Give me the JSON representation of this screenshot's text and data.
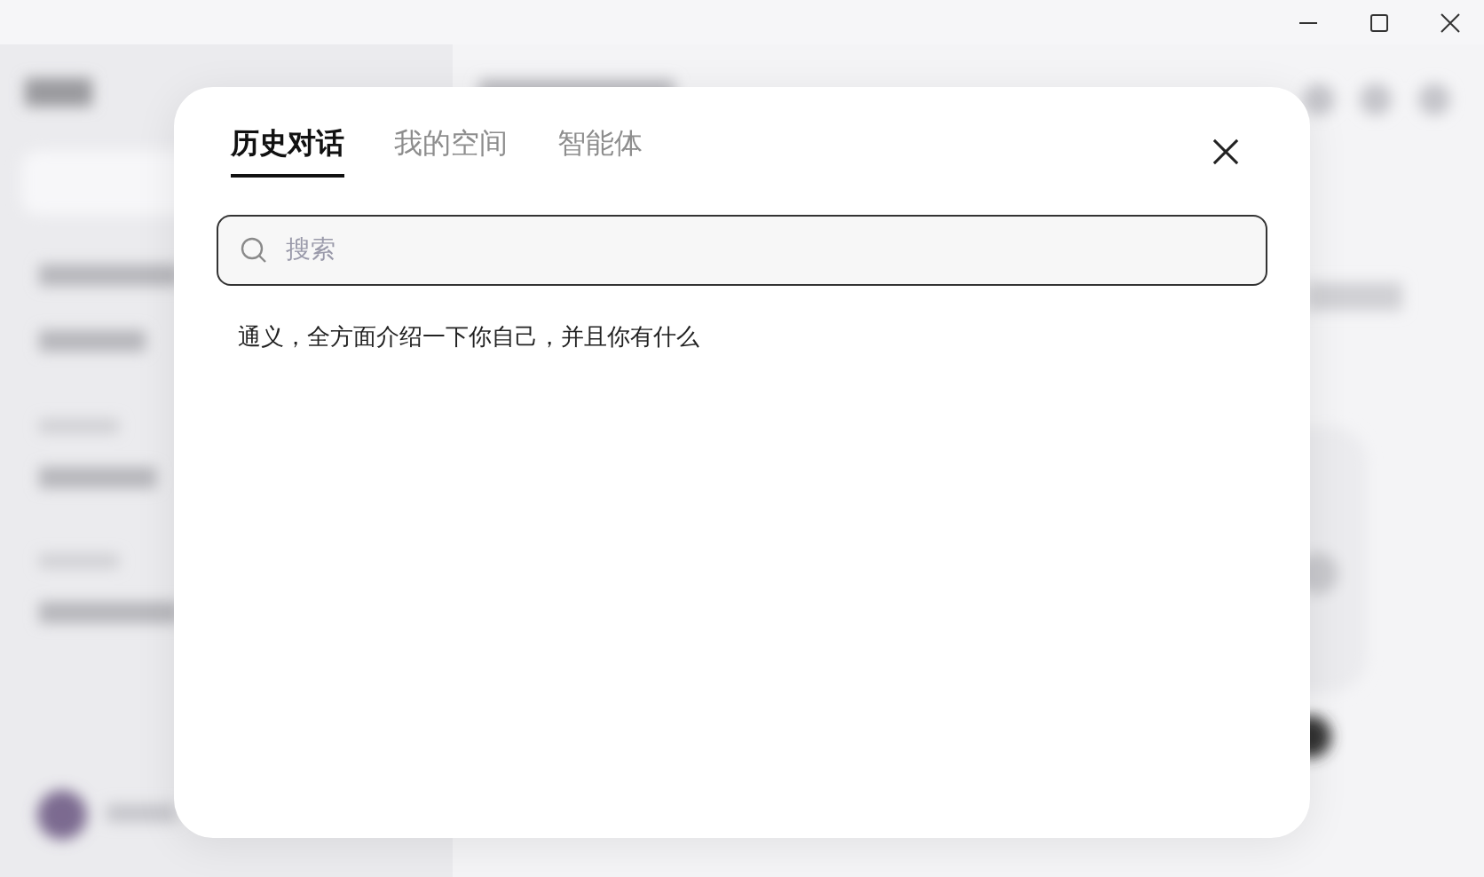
{
  "dialog": {
    "tabs": [
      {
        "label": "历史对话",
        "selected": true
      },
      {
        "label": "我的空间",
        "selected": false
      },
      {
        "label": "智能体",
        "selected": false
      }
    ],
    "search": {
      "placeholder": "搜索"
    },
    "history": [
      {
        "title": "通义，全方面介绍一下你自己，并且你有什么"
      }
    ]
  }
}
